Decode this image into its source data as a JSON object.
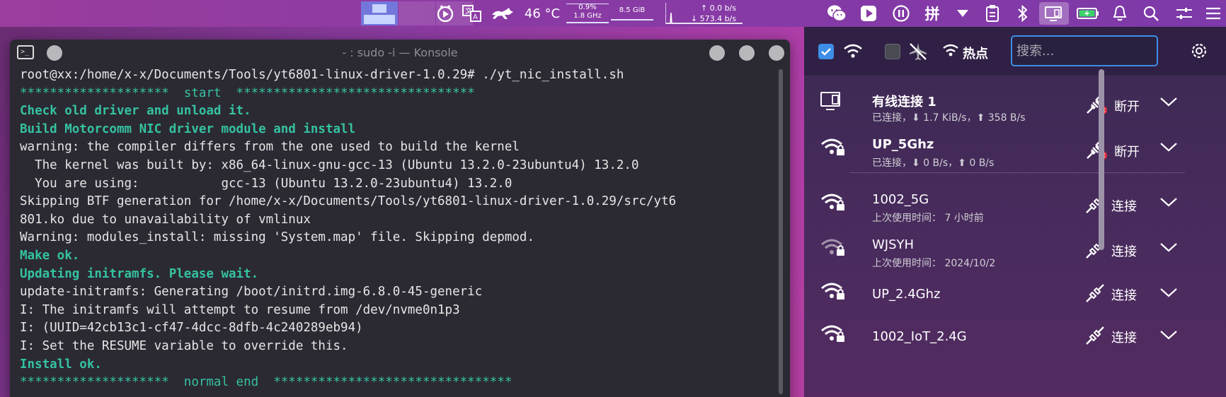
{
  "panel": {
    "temperature": "46 °C",
    "cpu_percent": "0.9%",
    "cpu_freq": "1.8 GHz",
    "memory": "8.5 GiB",
    "net_up": "0.0 b/s",
    "net_down": "573.4 b/s",
    "colors": {
      "panel_bg": "#8b3aa4",
      "pager_active": "#6e82e6"
    }
  },
  "konsole": {
    "title": "- : sudo -i — Konsole",
    "lines": [
      {
        "text": "root@xx:/home/x-x/Documents/Tools/yt6801-linux-driver-1.0.29# ./yt_nic_install.sh",
        "style": "normal"
      },
      {
        "text": "********************  start  ********************************",
        "style": "green"
      },
      {
        "text": "Check old driver and unload it.",
        "style": "hl"
      },
      {
        "text": "Build Motorcomm NIC driver module and install",
        "style": "hl"
      },
      {
        "text": "warning: the compiler differs from the one used to build the kernel",
        "style": "normal"
      },
      {
        "text": "  The kernel was built by: x86_64-linux-gnu-gcc-13 (Ubuntu 13.2.0-23ubuntu4) 13.2.0",
        "style": "normal"
      },
      {
        "text": "  You are using:           gcc-13 (Ubuntu 13.2.0-23ubuntu4) 13.2.0",
        "style": "normal"
      },
      {
        "text": "Skipping BTF generation for /home/x-x/Documents/Tools/yt6801-linux-driver-1.0.29/src/yt6",
        "style": "normal"
      },
      {
        "text": "801.ko due to unavailability of vmlinux",
        "style": "normal"
      },
      {
        "text": "Warning: modules_install: missing 'System.map' file. Skipping depmod.",
        "style": "normal"
      },
      {
        "text": "Make ok.",
        "style": "hl"
      },
      {
        "text": "Updating initramfs. Please wait.",
        "style": "hl"
      },
      {
        "text": "update-initramfs: Generating /boot/initrd.img-6.8.0-45-generic",
        "style": "normal"
      },
      {
        "text": "I: The initramfs will attempt to resume from /dev/nvme0n1p3",
        "style": "normal"
      },
      {
        "text": "I: (UUID=42cb13c1-cf47-4dcc-8dfb-4c240289eb94)",
        "style": "normal"
      },
      {
        "text": "I: Set the RESUME variable to override this.",
        "style": "normal"
      },
      {
        "text": "Install ok.",
        "style": "hl"
      },
      {
        "text": "********************  normal end  ********************************",
        "style": "green"
      }
    ]
  },
  "network": {
    "hotspot_label": "热点",
    "search_placeholder": "搜索...",
    "connections": [
      {
        "name": "有线连接 1",
        "status": "已连接，⬇ 1.7 KiB/s，⬆ 358 B/s",
        "action": "断开",
        "icon": "wired-icon",
        "connected": true
      },
      {
        "name": "UP_5Ghz",
        "status": "已连接，⬇ 0 B/s，⬆ 0 B/s",
        "action": "断开",
        "icon": "wifi-lock-icon",
        "connected": true
      },
      {
        "name": "1002_5G",
        "status": "上次使用时间： 7 小时前",
        "action": "连接",
        "icon": "wifi-lock-icon",
        "connected": false
      },
      {
        "name": "WJSYH",
        "status": "上次使用时间： 2024/10/2",
        "action": "连接",
        "icon": "wifi-lock-weak-icon",
        "connected": false
      },
      {
        "name": "UP_2.4Ghz",
        "status": "",
        "action": "连接",
        "icon": "wifi-lock-icon",
        "connected": false
      },
      {
        "name": "1002_IoT_2.4G",
        "status": "",
        "action": "连接",
        "icon": "wifi-lock-icon",
        "connected": false
      }
    ]
  }
}
